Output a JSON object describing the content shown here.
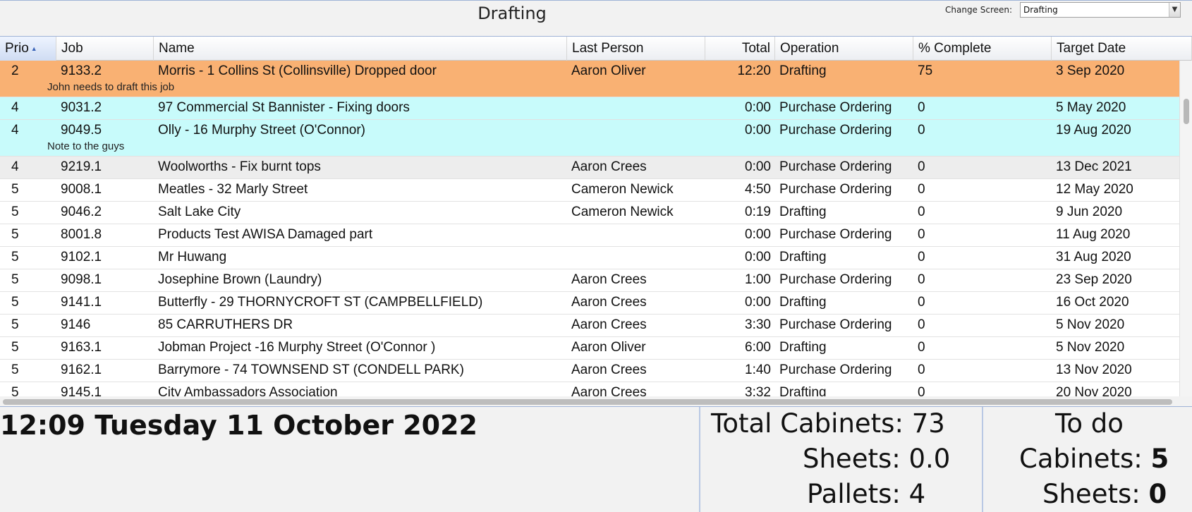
{
  "header": {
    "title": "Drafting",
    "change_screen_label": "Change Screen:",
    "change_screen_value": "Drafting"
  },
  "table": {
    "columns": [
      "Prio",
      "Job",
      "Name",
      "Last Person",
      "Total",
      "Operation",
      "% Complete",
      "Target Date"
    ],
    "sorted_column": "Prio",
    "rows": [
      {
        "prio": "2",
        "job": "9133.2",
        "name": "Morris - 1 Collins St (Collinsville) Dropped door",
        "last_person": "Aaron Oliver",
        "total": "12:20",
        "operation": "Drafting",
        "complete": "75",
        "target": "3 Sep 2020",
        "note": "John needs to draft this job",
        "color": "#f9b173"
      },
      {
        "prio": "4",
        "job": "9031.2",
        "name": "97 Commercial St Bannister - Fixing doors",
        "last_person": "",
        "total": "0:00",
        "operation": "Purchase Ordering",
        "complete": "0",
        "target": "5 May 2020",
        "note": "",
        "color": "#c8fbfb"
      },
      {
        "prio": "4",
        "job": "9049.5",
        "name": "Olly - 16 Murphy Street (O'Connor)",
        "last_person": "",
        "total": "0:00",
        "operation": "Purchase Ordering",
        "complete": "0",
        "target": "19 Aug 2020",
        "note": "Note to the guys",
        "color": "#c8fbfb"
      },
      {
        "prio": "4",
        "job": "9219.1",
        "name": "Woolworths - Fix burnt tops",
        "last_person": "Aaron Crees",
        "total": "0:00",
        "operation": "Purchase Ordering",
        "complete": "0",
        "target": "13 Dec 2021",
        "note": "",
        "color": "#ededed"
      },
      {
        "prio": "5",
        "job": "9008.1",
        "name": "Meatles - 32 Marly Street",
        "last_person": "Cameron Newick",
        "total": "4:50",
        "operation": "Purchase Ordering",
        "complete": "0",
        "target": "12 May 2020",
        "note": "",
        "color": "#ffffff"
      },
      {
        "prio": "5",
        "job": "9046.2",
        "name": "Salt Lake City",
        "last_person": "Cameron Newick",
        "total": "0:19",
        "operation": "Drafting",
        "complete": "0",
        "target": "9 Jun 2020",
        "note": "",
        "color": "#ffffff"
      },
      {
        "prio": "5",
        "job": "8001.8",
        "name": "Products Test AWISA Damaged part",
        "last_person": "",
        "total": "0:00",
        "operation": "Purchase Ordering",
        "complete": "0",
        "target": "11 Aug 2020",
        "note": "",
        "color": "#ffffff"
      },
      {
        "prio": "5",
        "job": "9102.1",
        "name": "Mr Huwang",
        "last_person": "",
        "total": "0:00",
        "operation": "Drafting",
        "complete": "0",
        "target": "31 Aug 2020",
        "note": "",
        "color": "#ffffff"
      },
      {
        "prio": "5",
        "job": "9098.1",
        "name": "Josephine Brown (Laundry)",
        "last_person": "Aaron Crees",
        "total": "1:00",
        "operation": "Purchase Ordering",
        "complete": "0",
        "target": "23 Sep 2020",
        "note": "",
        "color": "#ffffff"
      },
      {
        "prio": "5",
        "job": "9141.1",
        "name": "Butterfly - 29 THORNYCROFT ST (CAMPBELLFIELD)",
        "last_person": "Aaron Crees",
        "total": "0:00",
        "operation": "Drafting",
        "complete": "0",
        "target": "16 Oct 2020",
        "note": "",
        "color": "#ffffff"
      },
      {
        "prio": "5",
        "job": "9146",
        "name": "85 CARRUTHERS DR",
        "last_person": "Aaron Crees",
        "total": "3:30",
        "operation": "Purchase Ordering",
        "complete": "0",
        "target": "5 Nov 2020",
        "note": "",
        "color": "#ffffff"
      },
      {
        "prio": "5",
        "job": "9163.1",
        "name": "Jobman Project -16 Murphy Street (O'Connor )",
        "last_person": "Aaron Oliver",
        "total": "6:00",
        "operation": "Drafting",
        "complete": "0",
        "target": "5 Nov 2020",
        "note": "",
        "color": "#ffffff"
      },
      {
        "prio": "5",
        "job": "9162.1",
        "name": "Barrymore - 74 TOWNSEND ST (CONDELL PARK)",
        "last_person": "Aaron Crees",
        "total": "1:40",
        "operation": "Purchase Ordering",
        "complete": "0",
        "target": "13 Nov 2020",
        "note": "",
        "color": "#ffffff"
      },
      {
        "prio": "5",
        "job": "9145.1",
        "name": "City Ambassadors Association",
        "last_person": "Aaron Crees",
        "total": "3:32",
        "operation": "Drafting",
        "complete": "0",
        "target": "20 Nov 2020",
        "note": "",
        "color": "#ffffff"
      }
    ]
  },
  "footer": {
    "datetime": "12:09 Tuesday 11 October 2022",
    "total_cabinets_label": "Total Cabinets: ",
    "total_cabinets": "73",
    "sheets_label": "Sheets: ",
    "sheets": "0.0",
    "pallets_label": "Pallets: ",
    "pallets": "4",
    "todo_title": "To do",
    "todo_cabinets_label": "Cabinets: ",
    "todo_cabinets": "5",
    "todo_sheets_label": "Sheets: ",
    "todo_sheets": "0"
  }
}
